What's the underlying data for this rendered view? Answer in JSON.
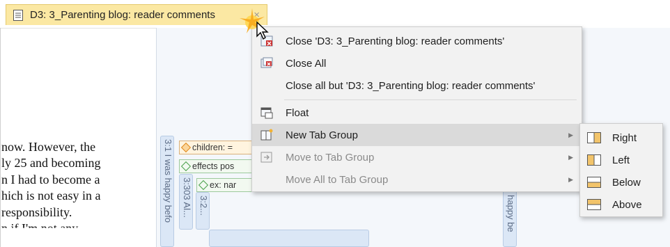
{
  "tab": {
    "title": "D3: 3_Parenting blog: reader comments",
    "close_glyph": "×",
    "icon": "document-icon"
  },
  "document_lines": [
    "now. However, the",
    "ly 25 and becoming",
    "n I had to become a",
    "hich is not easy in a",
    "responsibility.",
    "n if I'm not any"
  ],
  "margin": {
    "vertical_labels": [
      "3:1 I was happy befo",
      "3:303 Al...",
      "3:2...",
      "s happy be"
    ],
    "codes": [
      {
        "label": "children: =",
        "color": "orange"
      },
      {
        "label": "effects pos",
        "color": "green"
      },
      {
        "label": "ex: nar",
        "color": "green"
      }
    ]
  },
  "context_menu": {
    "items": [
      {
        "label": "Close 'D3: 3_Parenting blog: reader comments'",
        "icon": "close-tab-icon"
      },
      {
        "label": "Close All",
        "icon": "close-all-icon"
      },
      {
        "label": "Close all but 'D3: 3_Parenting blog: reader comments'",
        "icon": ""
      },
      {
        "label": "Float",
        "icon": "float-icon"
      },
      {
        "label": "New Tab Group",
        "icon": "new-tab-group-icon",
        "has_submenu": true
      },
      {
        "label": "Move to Tab Group",
        "icon": "move-to-tab-group-icon",
        "has_submenu": true,
        "disabled": true
      },
      {
        "label": "Move All to Tab Group",
        "icon": "",
        "has_submenu": true,
        "disabled": true
      }
    ],
    "submenu_arrow": "▶"
  },
  "submenu": {
    "items": [
      {
        "label": "Right",
        "icon": "split-right-icon"
      },
      {
        "label": "Left",
        "icon": "split-left-icon"
      },
      {
        "label": "Below",
        "icon": "split-below-icon"
      },
      {
        "label": "Above",
        "icon": "split-above-icon"
      }
    ]
  }
}
